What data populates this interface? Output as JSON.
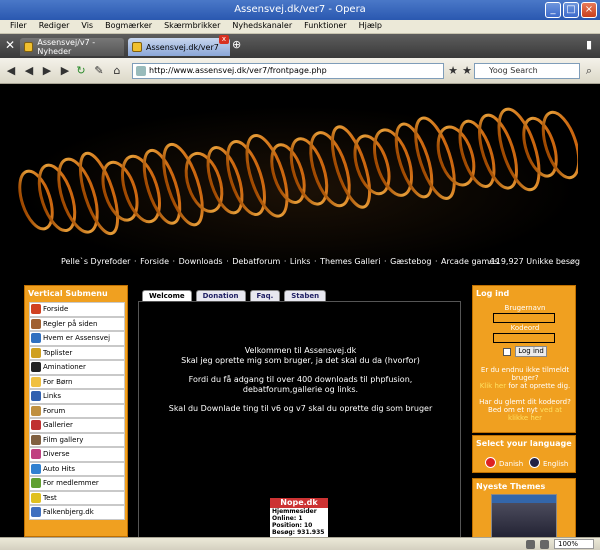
{
  "window": {
    "title": "Assensvej.dk/ver7 - Opera"
  },
  "menu": [
    "Filer",
    "Rediger",
    "Vis",
    "Bogmærker",
    "Skærmbrikker",
    "Nyhedskanaler",
    "Funktioner",
    "Hjælp"
  ],
  "tabs": [
    {
      "label": "Assensvej/v7 - Nyheder",
      "active": false
    },
    {
      "label": "Assensvej.dk/ver7",
      "active": true
    }
  ],
  "address": {
    "url": "http://www.assensvej.dk/ver7/frontpage.php",
    "search_placeholder": "Yoog Search"
  },
  "site": {
    "nav": [
      "Pelle`s Dyrefoder",
      "Forside",
      "Downloads",
      "Debatforum",
      "Links",
      "Themes Galleri",
      "Gæstebog",
      "Arcade games"
    ],
    "visits": ".119,927 Unikke besøg"
  },
  "left_panel": {
    "title": "Vertical Submenu",
    "items": [
      {
        "label": "Forside",
        "color": "#d04020"
      },
      {
        "label": "Regler på siden",
        "color": "#a06030"
      },
      {
        "label": "Hvem er Assensvej",
        "color": "#3070c0"
      },
      {
        "label": "Toplister",
        "color": "#d0a020"
      },
      {
        "label": "Aminationer",
        "color": "#222222"
      },
      {
        "label": "For Børn",
        "color": "#f0c040"
      },
      {
        "label": "Links",
        "color": "#3060b0"
      },
      {
        "label": "Forum",
        "color": "#c09040"
      },
      {
        "label": "Gallerier",
        "color": "#c03030"
      },
      {
        "label": "Film gallery",
        "color": "#806040"
      },
      {
        "label": "Diverse",
        "color": "#c04080"
      },
      {
        "label": "Auto Hits",
        "color": "#3080d0"
      },
      {
        "label": "For medlemmer",
        "color": "#60a030"
      },
      {
        "label": "Test",
        "color": "#e0c020"
      },
      {
        "label": "Falkenbjerg.dk",
        "color": "#4070c0"
      }
    ]
  },
  "content_tabs": [
    {
      "label": "Welcome",
      "active": true
    },
    {
      "label": "Donation",
      "active": false
    },
    {
      "label": "Faq.",
      "active": false
    },
    {
      "label": "Staben",
      "active": false
    }
  ],
  "welcome": {
    "line1": "Velkommen til Assensvej.dk",
    "line2": "Skal jeg oprette mig som bruger, ja det skal du da (hvorfor)",
    "line3": "Fordi du få adgang til over 400 downloads til phpfusion,",
    "line4": "debatforum,gallerie og links.",
    "line5": "Skal du Downlade ting til v6 og v7 skal du oprette dig som bruger"
  },
  "counter": {
    "title": "Nope.dk",
    "line1": "Hjemmesider",
    "online": "Online:  1",
    "position": "Position:  10",
    "visits": "Besøg:  931.935"
  },
  "login": {
    "title": "Log ind",
    "username_label": "Brugernavn",
    "password_label": "Kodeord",
    "button": "Log ind",
    "register_text": "Er du endnu ikke tilmeldt bruger?",
    "register_link": "Klik her",
    "register_after": "for at oprette dig.",
    "forgot_text": "Har du glemt dit kodeord?",
    "forgot_prefix": "Bed om et nyt",
    "forgot_link": "ved at klikke her"
  },
  "language": {
    "title": "Select your language",
    "danish": "Danish",
    "english": "English"
  },
  "themes": {
    "title": "Nyeste Themes"
  },
  "status": {
    "zoom": "100%"
  }
}
